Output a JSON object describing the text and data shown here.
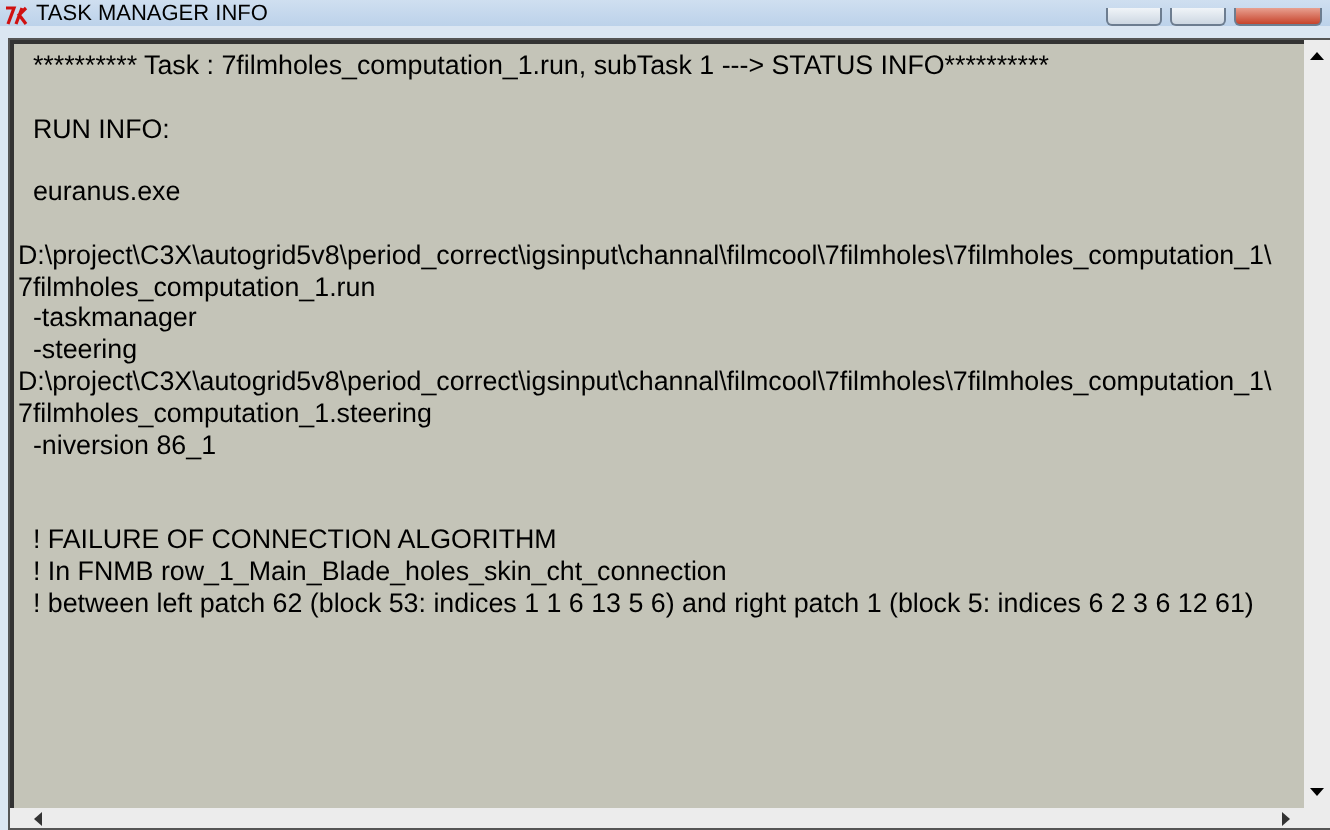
{
  "window": {
    "title": "TASK MANAGER INFO"
  },
  "log_text": "  ********** Task : 7filmholes_computation_1.run, subTask 1 ---> STATUS INFO**********\n\n  RUN INFO:\n\n  euranus.exe\n  D:\\project\\C3X\\autogrid5v8\\period_correct\\igsinput\\channal\\filmcool\\7filmholes\\7filmholes_computation_1\\7filmholes_computation_1.run\n  -taskmanager\n  -steering D:\\project\\C3X\\autogrid5v8\\period_correct\\igsinput\\channal\\filmcool\\7filmholes\\7filmholes_computation_1\\7filmholes_computation_1.steering\n  -niversion 86_1\n\n\n  ! FAILURE OF CONNECTION ALGORITHM\n  ! In FNMB row_1_Main_Blade_holes_skin_cht_connection\n  ! between left patch 62 (block 53: indices 1 1 6 13 5 6) and right patch 1 (block 5: indices 6 2 3 6 12 61)"
}
